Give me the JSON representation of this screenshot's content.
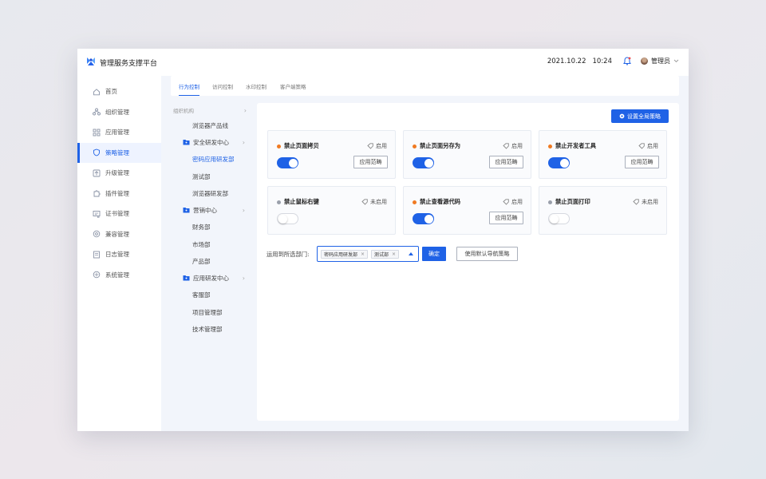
{
  "app": {
    "title": "管理服务支撑平台"
  },
  "header": {
    "date": "2021.10.22",
    "time": "10:24",
    "user": "管理员"
  },
  "sidebar": {
    "items": [
      {
        "label": "首页",
        "icon": "home-icon"
      },
      {
        "label": "组织管理",
        "icon": "org-icon"
      },
      {
        "label": "应用管理",
        "icon": "apps-icon"
      },
      {
        "label": "策略管理",
        "icon": "shield-icon",
        "active": true
      },
      {
        "label": "升级管理",
        "icon": "upgrade-icon"
      },
      {
        "label": "插件管理",
        "icon": "plugin-icon"
      },
      {
        "label": "证书管理",
        "icon": "certificate-icon"
      },
      {
        "label": "兼容管理",
        "icon": "compat-icon"
      },
      {
        "label": "日志管理",
        "icon": "log-icon"
      },
      {
        "label": "系统管理",
        "icon": "settings-icon"
      }
    ]
  },
  "tabs": [
    {
      "label": "行为控制",
      "active": true
    },
    {
      "label": "访问控制"
    },
    {
      "label": "水印控制"
    },
    {
      "label": "客户端策略"
    }
  ],
  "tree": {
    "header": "组织机构",
    "items": [
      {
        "label": "浏览器产品线",
        "level": 1
      },
      {
        "label": "安全研发中心",
        "level": 0,
        "folder": true
      },
      {
        "label": "密码应用研发部",
        "level": 1,
        "selected": true
      },
      {
        "label": "测试部",
        "level": 1
      },
      {
        "label": "浏览器研发部",
        "level": 1
      },
      {
        "label": "营销中心",
        "level": 0,
        "folder": true
      },
      {
        "label": "财务部",
        "level": 1
      },
      {
        "label": "市场部",
        "level": 1
      },
      {
        "label": "产品部",
        "level": 1
      },
      {
        "label": "应用研发中心",
        "level": 0,
        "folder": true
      },
      {
        "label": "客服部",
        "level": 1
      },
      {
        "label": "项目管理部",
        "level": 1
      },
      {
        "label": "技术管理部",
        "level": 1
      }
    ]
  },
  "panel": {
    "global_button": "设置全局策略",
    "cards": [
      {
        "title": "禁止页面拷贝",
        "status": "启用",
        "on": true,
        "dot_color": "#f07a22",
        "scope_label": "应用范畴"
      },
      {
        "title": "禁止页面另存为",
        "status": "启用",
        "on": true,
        "dot_color": "#f07a22",
        "scope_label": "应用范畴"
      },
      {
        "title": "禁止开发者工具",
        "status": "启用",
        "on": true,
        "dot_color": "#f07a22",
        "scope_label": "应用范畴"
      },
      {
        "title": "禁止鼠标右键",
        "status": "未启用",
        "on": false,
        "dot_color": "#9aa0ab",
        "scope_label": ""
      },
      {
        "title": "禁止查看源代码",
        "status": "启用",
        "on": true,
        "dot_color": "#f07a22",
        "scope_label": "应用范畴"
      },
      {
        "title": "禁止页面打印",
        "status": "未启用",
        "on": false,
        "dot_color": "#9aa0ab",
        "scope_label": ""
      }
    ],
    "apply_label": "运用到所选部门:",
    "selected_depts": [
      "密码应用研发部",
      "测试部"
    ],
    "confirm_label": "确定",
    "default_label": "使用默认导航策略"
  },
  "colors": {
    "accent": "#1f62e6",
    "enabled_dot": "#f07a22",
    "disabled_dot": "#9aa0ab"
  }
}
